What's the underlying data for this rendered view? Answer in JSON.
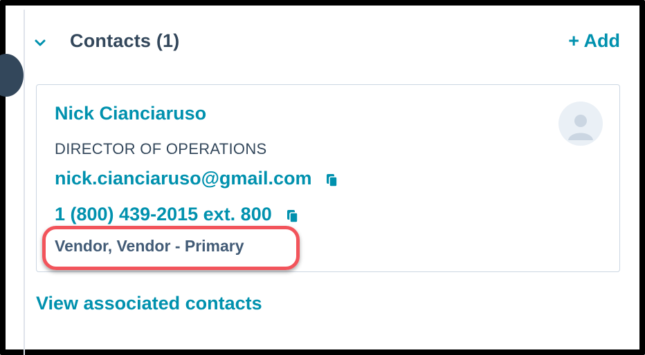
{
  "section": {
    "title": "Contacts (1)",
    "add_label": "+ Add",
    "view_all_label": "View associated contacts"
  },
  "contact": {
    "name": "Nick Cianciaruso",
    "job_title": "DIRECTOR OF OPERATIONS",
    "email": "nick.cianciaruso@gmail.com",
    "phone": "1 (800) 439-2015 ext. 800",
    "association_labels": "Vendor, Vendor - Primary"
  },
  "icons": {
    "collapse": "chevron-down-icon",
    "copy": "copy-icon",
    "avatar": "person-placeholder-icon"
  },
  "colors": {
    "link": "#0091ae",
    "heading": "#33475b",
    "highlight": "#f2545b",
    "card_border": "#cbd6e2"
  }
}
